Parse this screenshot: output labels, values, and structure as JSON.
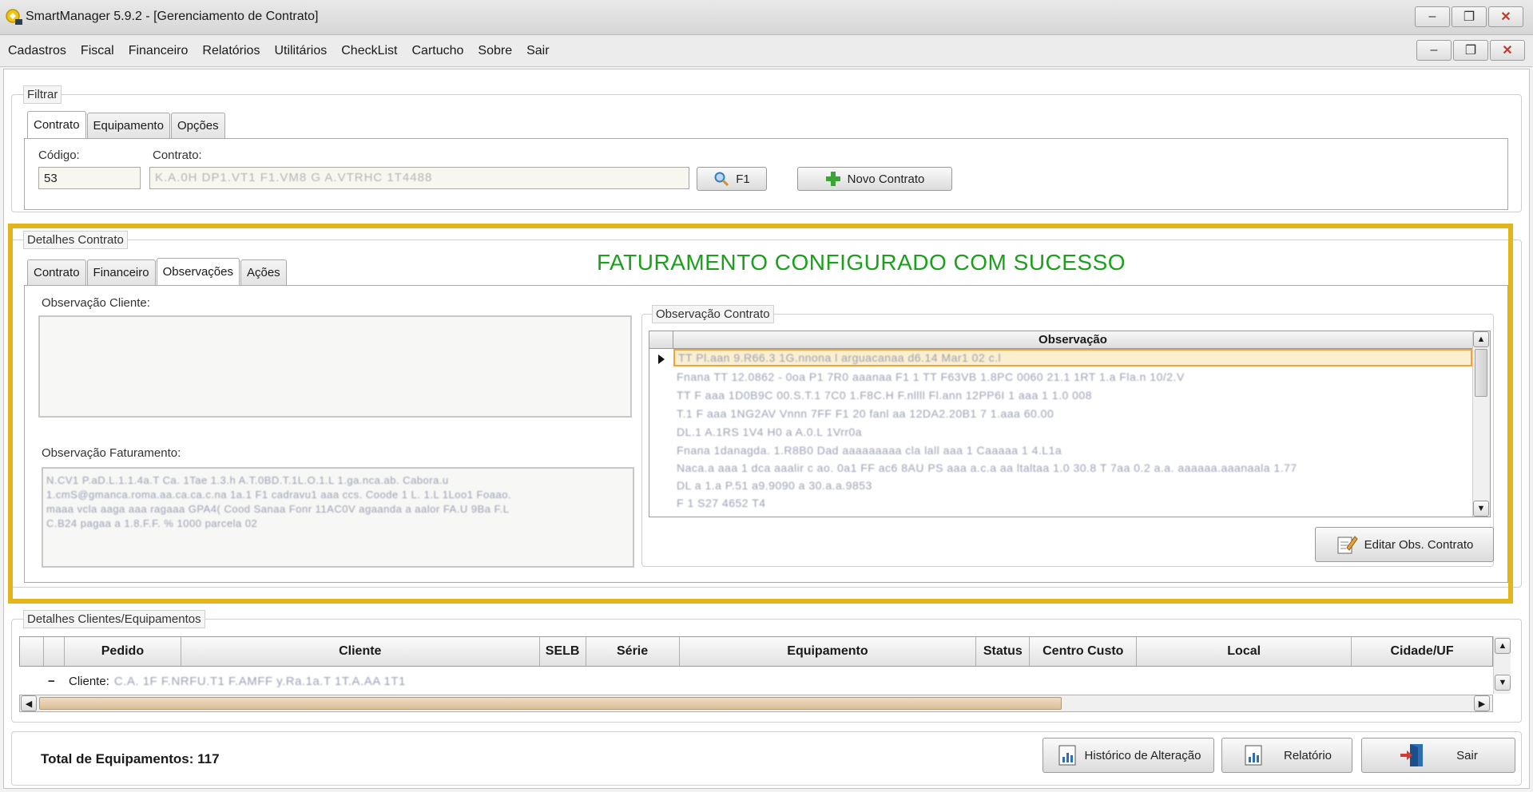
{
  "window": {
    "title": "SmartManager 5.9.2 - [Gerenciamento de Contrato]",
    "min": "–",
    "restore": "❐",
    "close": "✕"
  },
  "menu": [
    "Cadastros",
    "Fiscal",
    "Financeiro",
    "Relatórios",
    "Utilitários",
    "CheckList",
    "Cartucho",
    "Sobre",
    "Sair"
  ],
  "filtrar": {
    "legend": "Filtrar",
    "tabs": [
      "Contrato",
      "Equipamento",
      "Opções"
    ],
    "codigo_label": "Código:",
    "codigo_value": "53",
    "contrato_label": "Contrato:",
    "contrato_value": "K.A.0H DP1.VT1 F1.VM8 G A.VTRHC 1T4488",
    "search_btn": "F1",
    "novo_btn": "Novo Contrato"
  },
  "detalhes": {
    "legend": "Detalhes Contrato",
    "tabs": [
      "Contrato",
      "Financeiro",
      "Observações",
      "Ações"
    ],
    "success_message": "FATURAMENTO CONFIGURADO COM SUCESSO",
    "obs_cliente_label": "Observação Cliente:",
    "obs_faturamento_label": "Observação Faturamento:",
    "obs_faturamento_lines": [
      "N.CV1 P.aD.L.1.1.4a.T Ca. 1Tae 1.3.h                 A.T.0BD.T.1L.O.1.L   1.ga.nca.ab. Cabora.u",
      "1.cmS@gmanca.roma.aa.ca.ca.c.na  1a.1   F1 cadravu1 aaa ccs. Coode   1 L.  1.L  1Loo1  Foaao.",
      "maaa vcla aaga aaa ragaaa GPA4( Cood Sanaa Fonr 11AC0V agaanda a aalor FA.U 9Ba F.L",
      "C.B24 pagaa a 1.8.F.F. % 1000 parcela 02"
    ],
    "obs_contrato_legend": "Observação Contrato",
    "grid_header": "Observação",
    "grid_rows": [
      "TT Pl.aan 9.R66.3 1G.nnona l arguacanaa d6.14   Mar1 02 c.l",
      "Fnana TT 12.0862  - 0oa  P1 7R0 aaanaa F1 1 TT F63VB 1.8PC 0060 21.1 1RT  1.a   Fla.n  10/2.V",
      "TT  F  aaa 1D0B9C 00.S.T.1 7C0 1.F8C.H F.nllll Fl.ann 12PP6I 1 aaa 1 1.0 008",
      "T.1  F  aaa 1NG2AV  Vnnn 7FF F1 20 fanl aa 12DA2.20B1 7 1.aaa  60.00",
      "DL.1  A.1RS 1V4 H0 a  A.0.L 1Vrr0a",
      "Fnana 1danagda. 1.R8B0  Dad aaaaaaaaa cla  lall aaa 1 Caaaaa 1 4.L1a",
      "Naca.a aaa 1 dca aaalir c ao. 0a1 FF ac6 8AU PS aaa a.c.a aa ltaltaa 1.0 30.8 T 7aa  0.2 a.a. aaaaaa.aaanaala 1.77",
      "DL  a   1.a  P.51 a9.9090  a 30.a.a.9853",
      "F 1 S27 4652 T4"
    ],
    "editar_btn": "Editar Obs. Contrato"
  },
  "equip": {
    "legend": "Detalhes Clientes/Equipamentos",
    "columns": [
      "Pedido",
      "Cliente",
      "SELB",
      "Série",
      "Equipamento",
      "Status",
      "Centro Custo",
      "Local",
      "Cidade/UF"
    ],
    "row_prefix": "Cliente:",
    "row_value": "C.A. 1F F.NRFU.T1 F.AMFF y.Ra.1a.T  1T.A.AA   1T1",
    "collapse": "−"
  },
  "footer": {
    "total_label": "Total de Equipamentos: 117",
    "historico_btn": "Histórico de Alteração",
    "relatorio_btn": "Relatório",
    "sair_btn": "Sair"
  }
}
